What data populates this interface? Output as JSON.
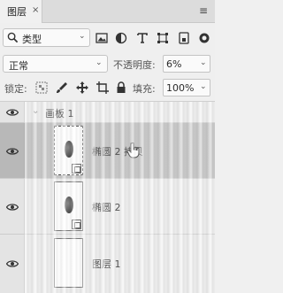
{
  "tab": {
    "label": "图层",
    "close_glyph": "×",
    "menu_glyph": "≡"
  },
  "filter": {
    "label": "类型",
    "chevron": "⌄"
  },
  "blend": {
    "mode": "正常",
    "chevron": "⌄"
  },
  "opacity": {
    "label": "不透明度:",
    "value": "6%",
    "chevron": "⌄"
  },
  "lock": {
    "label": "锁定:"
  },
  "fill": {
    "label": "填充:",
    "value": "100%",
    "chevron": "⌄"
  },
  "group": {
    "name": "画板 1",
    "chevron": "⌄"
  },
  "layers": [
    {
      "name": "椭圆 2 拷贝",
      "selected": true
    },
    {
      "name": "椭圆 2",
      "selected": false
    },
    {
      "name": "图层 1",
      "selected": false
    }
  ],
  "icons": {
    "filter_image": "image-filter-icon",
    "filter_adjust": "adjustment-filter-icon",
    "filter_text": "text-filter-icon",
    "filter_shape": "shape-filter-icon",
    "filter_smart": "smart-object-filter-icon",
    "filter_toggle": "filter-toggle-icon"
  },
  "colors": {
    "panel": "#efefef",
    "selected_row": "#a0a0a0"
  }
}
